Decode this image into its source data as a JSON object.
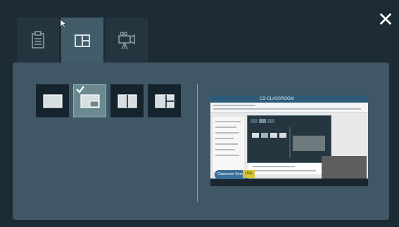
{
  "window": {
    "tabs": [
      {
        "icon": "clipboard-icon",
        "active": false
      },
      {
        "icon": "layout-icon",
        "active": true
      },
      {
        "icon": "camera-icon",
        "active": false
      }
    ],
    "close_icon": "close-icon"
  },
  "layouts": {
    "options": [
      {
        "name": "full-screen",
        "selected": false
      },
      {
        "name": "picture-in-picture",
        "selected": true
      },
      {
        "name": "side-by-side",
        "selected": false
      },
      {
        "name": "main-with-two-panels",
        "selected": false
      }
    ],
    "selected_icon": "checkmark-icon"
  },
  "preview": {
    "title": "CS-CLASSROOM",
    "pill_label": "Classroom Stream",
    "badge_label": "LIVE"
  },
  "colors": {
    "background": "#1d2b34",
    "panel": "#405765",
    "active_tab": "#435c6a",
    "selected_layout": "#6b8a90"
  }
}
